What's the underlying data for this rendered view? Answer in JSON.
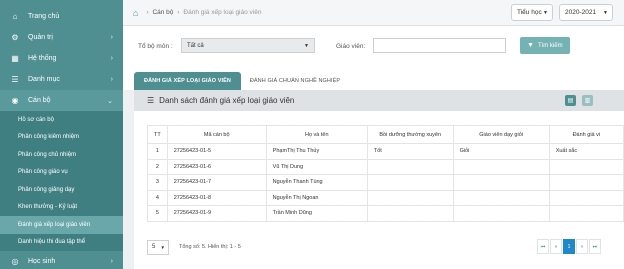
{
  "sidebar": {
    "items": [
      {
        "label": "Trang chủ",
        "icon": "home-icon"
      },
      {
        "label": "Quản trị",
        "icon": "gear-icon"
      },
      {
        "label": "Hệ thống",
        "icon": "grid-icon"
      },
      {
        "label": "Danh mục",
        "icon": "list-icon"
      },
      {
        "label": "Cán bộ",
        "icon": "user-icon"
      }
    ],
    "sub_items": [
      "Hồ sơ cán bộ",
      "Phân công kiêm nhiệm",
      "Phân công chủ nhiệm",
      "Phân công giáo vụ",
      "Phân công giảng dạy",
      "Khen thưởng - Kỷ luật",
      "Đánh giá xếp loại giáo viên",
      "Danh hiệu thi đua tập thể"
    ],
    "next_item": {
      "label": "Học sinh",
      "icon": "student-icon"
    }
  },
  "breadcrumb": {
    "parent": "Cán bộ",
    "current": "Đánh giá xếp loại giáo viên"
  },
  "selects": {
    "level": "Tiểu học",
    "year": "2020-2021"
  },
  "filter": {
    "department_label": "Tổ bộ môn :",
    "department_value": "Tất cả",
    "teacher_label": "Giáo viên:",
    "search_label": "Tìm kiếm"
  },
  "tabs": [
    "ĐÁNH GIÁ XẾP LOẠI GIÁO VIÊN",
    "ĐÁNH GIÁ CHUẨN NGHỀ NGHIỆP"
  ],
  "panel_title": "Danh sách đánh giá xếp loại giáo viên",
  "table": {
    "headers": [
      "TT",
      "Mã cán bộ",
      "Họ và tên",
      "Bồi dưỡng thường xuyên",
      "Giáo viên dạy giỏi",
      "Đánh giá vi"
    ],
    "rows": [
      [
        "1",
        "27256423-01-5",
        "PhạmThị Thu Thủy",
        "Tốt",
        "Giỏi",
        "Xuất sắc"
      ],
      [
        "2",
        "27256423-01-6",
        "Vũ Thị Dung",
        "",
        "",
        ""
      ],
      [
        "3",
        "27256423-01-7",
        "Nguyễn Thanh Tùng",
        "",
        "",
        ""
      ],
      [
        "4",
        "27256423-01-8",
        "Nguyễn Thị Ngoan",
        "",
        "",
        ""
      ],
      [
        "5",
        "27256423-01-9",
        "Trần Minh Dũng",
        "",
        "",
        ""
      ]
    ]
  },
  "footer": {
    "page_size": "5",
    "summary": "Tổng số: 5. Hiển thị: 1 - 5",
    "current_page": "1"
  },
  "colors": {
    "sidebar": "#4f8f92",
    "accent": "#4f8f92",
    "search_button": "#75b2b4",
    "page_active": "#1e88c8"
  }
}
